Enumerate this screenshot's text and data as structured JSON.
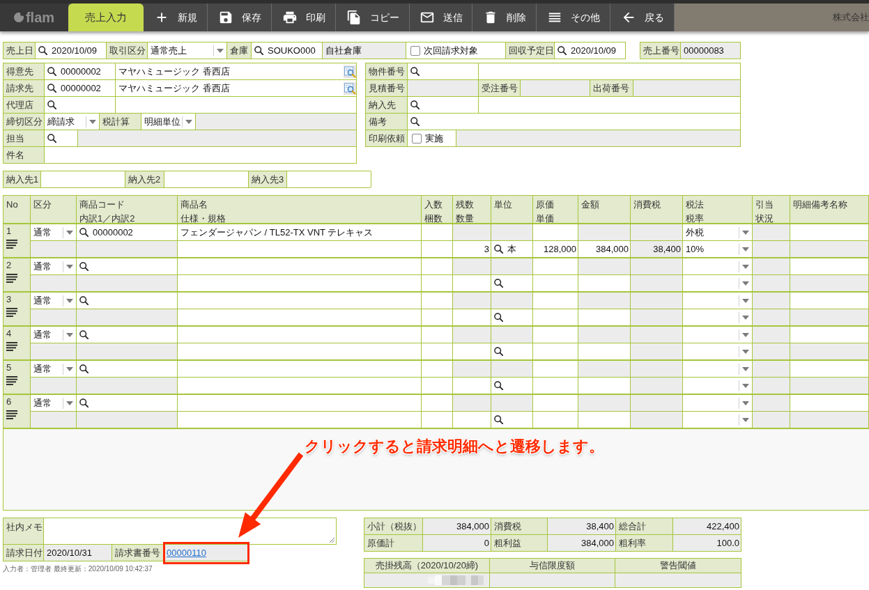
{
  "topbar": {
    "logo": "flam",
    "screen_tab": {
      "label": "売上入力",
      "selected": true
    },
    "toolbar": [
      {
        "kind": "add",
        "label": "新規"
      },
      {
        "kind": "save",
        "label": "保存"
      },
      {
        "kind": "print",
        "label": "印刷"
      },
      {
        "kind": "copy",
        "label": "コピー"
      },
      {
        "kind": "send",
        "label": "送信"
      },
      {
        "kind": "delete",
        "label": "削除"
      },
      {
        "kind": "more",
        "label": "その他"
      },
      {
        "kind": "back",
        "label": "戻る"
      }
    ],
    "company": "株式会社"
  },
  "header": {
    "sales_date": {
      "label": "売上日",
      "value": "2020/10/09"
    },
    "transaction_type": {
      "label": "取引区分",
      "value": "通常売上"
    },
    "warehouse": {
      "label": "倉庫",
      "code": "SOUKO000",
      "name": "自社倉庫"
    },
    "next_billing": {
      "label": "次回請求対象",
      "checked": false
    },
    "collection_date": {
      "label": "回収予定日",
      "value": "2020/10/09"
    },
    "sales_number": {
      "label": "売上番号",
      "value": "00000083"
    }
  },
  "customer": {
    "customer": {
      "label": "得意先",
      "code": "00000002",
      "name": "マヤハミュージック 香西店"
    },
    "billing_to": {
      "label": "請求先",
      "code": "00000002",
      "name": "マヤハミュージック 香西店"
    },
    "agent": {
      "label": "代理店"
    },
    "closing_type": {
      "label": "締切区分",
      "value": "締請求"
    },
    "tax_calculation": {
      "label": "税計算",
      "value": "明細単位"
    },
    "staff": {
      "label": "担当"
    },
    "subject": {
      "label": "件名"
    }
  },
  "reference": {
    "property_number": {
      "label": "物件番号"
    },
    "estimate_number": {
      "label": "見積番号"
    },
    "order_number": {
      "label": "受注番号"
    },
    "shipment_number": {
      "label": "出荷番号"
    },
    "delivery_to": {
      "label": "納入先"
    },
    "remarks": {
      "label": "備考"
    },
    "print_request": {
      "label": "印刷依頼",
      "option": "実施",
      "checked": false
    }
  },
  "deliveries": [
    {
      "label": "納入先1"
    },
    {
      "label": "納入先2"
    },
    {
      "label": "納入先3"
    }
  ],
  "lines": {
    "columns": [
      {
        "labels": [
          "No"
        ]
      },
      {
        "labels": [
          "区分"
        ]
      },
      {
        "labels": [
          "商品コード",
          "内訳1／内訳2"
        ]
      },
      {
        "labels": [
          "商品名",
          "仕様・規格"
        ]
      },
      {
        "labels": [
          "入数",
          "梱数"
        ]
      },
      {
        "labels": [
          "残数",
          "数量"
        ]
      },
      {
        "labels": [
          "単位"
        ]
      },
      {
        "labels": [
          "原価",
          "単価"
        ]
      },
      {
        "labels": [
          "金額"
        ]
      },
      {
        "labels": [
          "消費税"
        ]
      },
      {
        "labels": [
          "税法",
          "税率"
        ]
      },
      {
        "labels": [
          "引当",
          "状況"
        ]
      },
      {
        "labels": [
          "明細備考名称"
        ]
      }
    ],
    "rows": [
      {
        "no": "1",
        "category": "通常",
        "product_code": "00000002",
        "product_name": "フェンダージャパン / TL52-TX VNT テレキャス",
        "quantity": "3",
        "unit": "本",
        "unit_price": "128,000",
        "amount": "384,000",
        "tax": "38,400",
        "tax_method": "外税",
        "tax_rate": "10%"
      },
      {
        "no": "2",
        "category": "通常"
      },
      {
        "no": "3",
        "category": "通常"
      },
      {
        "no": "4",
        "category": "通常"
      },
      {
        "no": "5",
        "category": "通常"
      },
      {
        "no": "6",
        "category": "通常"
      }
    ]
  },
  "annotation": {
    "text": "クリックすると請求明細へと遷移します。"
  },
  "memo": {
    "label": "社内メモ"
  },
  "billing_date": {
    "label": "請求日付",
    "value": "2020/10/31"
  },
  "invoice_number": {
    "label": "請求書番号",
    "value": "00000110"
  },
  "footer": "入力者：管理者 最終更新：2020/10/09 10:42:37",
  "totals": {
    "rows": [
      {
        "cells": [
          {
            "label": "小計（税抜）",
            "value": "384,000"
          },
          {
            "label": "消費税",
            "value": "38,400"
          },
          {
            "label": "総合計",
            "value": "422,400"
          }
        ]
      },
      {
        "cells": [
          {
            "label": "原価計",
            "value": "0"
          },
          {
            "label": "粗利益",
            "value": "384,000"
          },
          {
            "label": "粗利率",
            "value": "100.0"
          }
        ]
      }
    ]
  },
  "balance": {
    "columns": [
      {
        "label": "売掛残高（2020/10/20締)"
      },
      {
        "label": "与信限度額"
      },
      {
        "label": "警告閾値"
      }
    ]
  }
}
